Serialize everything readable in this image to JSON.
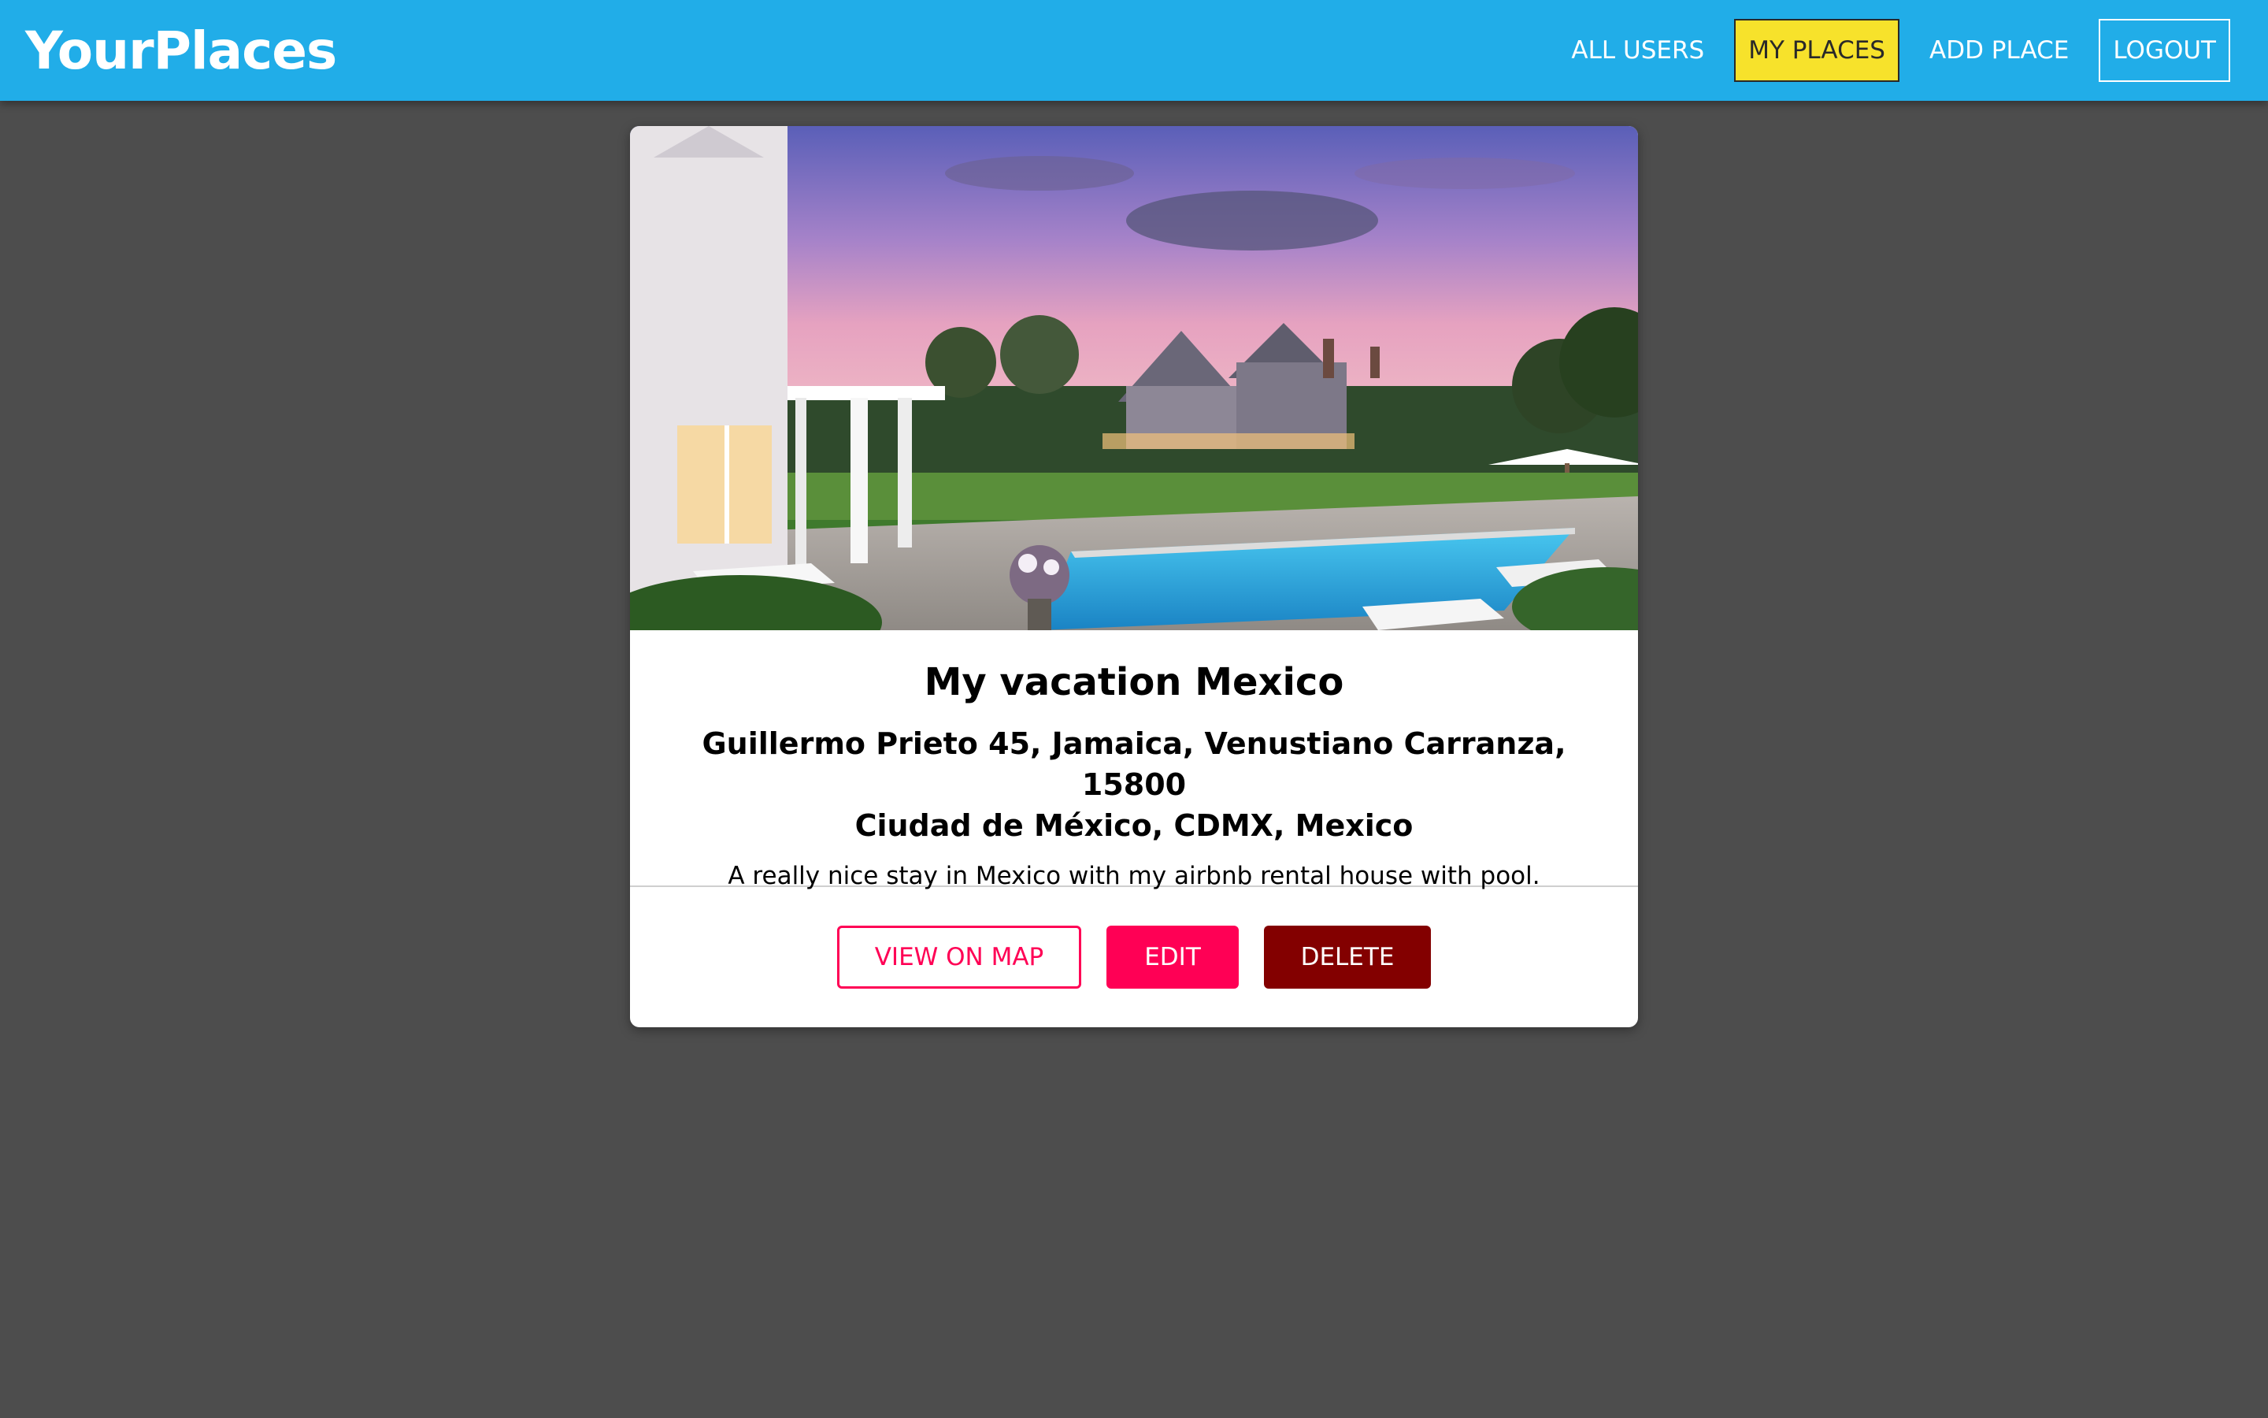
{
  "header": {
    "brand": "YourPlaces",
    "nav": {
      "all_users": "ALL USERS",
      "my_places": "MY PLACES",
      "add_place": "ADD PLACE",
      "logout": "LOGOUT"
    },
    "colors": {
      "header_bg": "#21ade8",
      "active_bg": "#f7e22b"
    }
  },
  "place": {
    "image_alt": "My vacation Mexico",
    "title": "My vacation Mexico",
    "address_line1": "Guillermo Prieto 45, Jamaica, Venustiano Carranza, 15800",
    "address_line2": "Ciudad de México, CDMX, Mexico",
    "description": "A really nice stay in Mexico with my airbnb rental house with pool."
  },
  "actions": {
    "view_on_map": "VIEW ON MAP",
    "edit": "EDIT",
    "delete": "DELETE"
  }
}
